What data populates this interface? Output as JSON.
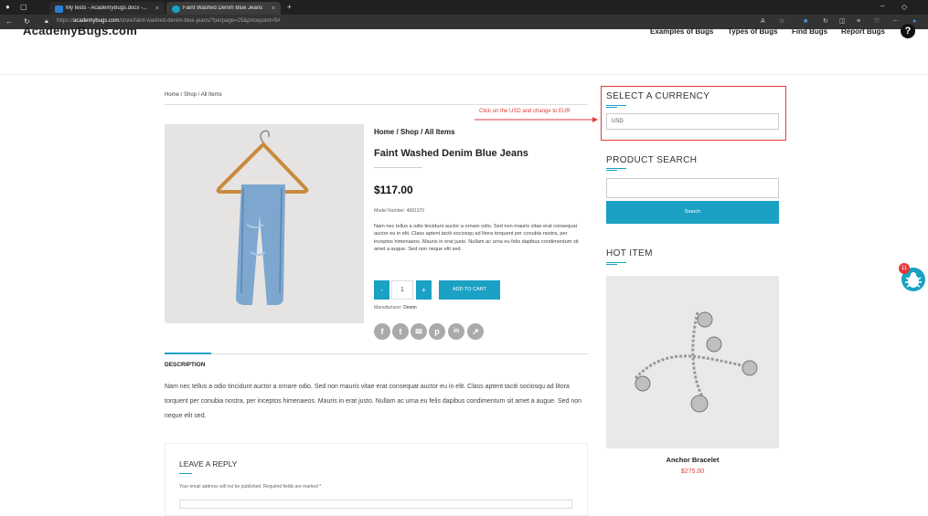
{
  "browser": {
    "tabs": [
      {
        "title": "My tests - AcademyBugs.docx -..."
      },
      {
        "title": "Faint Washed Denim Blue Jeans"
      }
    ],
    "url_prefix": "https://",
    "url_domain": "academybugs.com",
    "url_path": "/store/faint-washed-denim-blue-jeans/?perpage=25&pricepoint=5#"
  },
  "site": {
    "brand": "AcademyBugs.com",
    "nav": [
      "Examples of Bugs",
      "Types of Bugs",
      "Find Bugs",
      "Report Bugs"
    ],
    "help": "?"
  },
  "breadcrumb_top": "Home / Shop / All Items",
  "product": {
    "breadcrumb": "Home / Shop / All Items",
    "title": "Faint Washed Denim Blue Jeans",
    "price": "$117.00",
    "model": "Model Number: 4681370",
    "description": "Nam nec tellus a odio tincidunt auctor a ornare odio. Sed non mauris vitae erat consequat auctor eu in elit. Class aptent taciti sociosqu ad litora torquent per conubia nostra, per inceptos himenaeos. Mauris in erat justo. Nullam ac urna eu felis dapibus condimentum sit amet a augue. Sed non neque elit sed.",
    "qty_minus": "-",
    "quantity": "1",
    "qty_plus": "+",
    "add_to_cart": "ADD TO CART",
    "manufacturer_label": "Manufacturer:",
    "manufacturer": "Denim",
    "share_icons": [
      "facebook-icon",
      "twitter-icon",
      "email-icon",
      "pinterest-icon",
      "linkedin-icon",
      "share-icon"
    ]
  },
  "description_tab": {
    "label": "DESCRIPTION",
    "body": "Nam nec tellus a odio tincidunt auctor a ornare odio. Sed non mauris vitae erat consequat auctor eu in elit. Class aptent taciti sociosqu ad litora torquent per conubia nostra, per inceptos himenaeos. Mauris in erat justo. Nullam ac urna eu felis dapibus condimentum sit amet a augue. Sed non neque elit sed."
  },
  "reply": {
    "title": "LEAVE A REPLY",
    "note": "Your email address will not be published. Required fields are marked *"
  },
  "annotation": {
    "text": "Click on the USD and change to EUR",
    "color": "#e23b3b"
  },
  "sidebar": {
    "currency_title": "SELECT A CURRENCY",
    "currency_value": "USD",
    "search_title": "PRODUCT SEARCH",
    "search_button": "Search",
    "hot_title": "HOT ITEM",
    "hot_name": "Anchor Bracelet",
    "hot_price": "$275.00"
  },
  "bug_widget": {
    "badge": "11"
  },
  "colors": {
    "accent": "#1aa1c4",
    "annotation": "#e23b3b"
  }
}
